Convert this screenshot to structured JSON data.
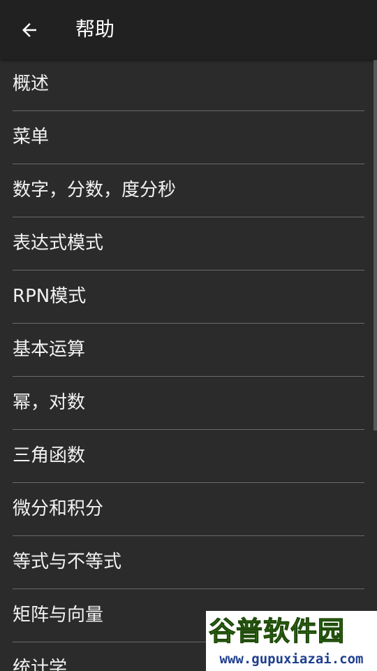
{
  "header": {
    "back_icon": "arrow-left-icon",
    "title": "帮助"
  },
  "help_topics": [
    {
      "label": "概述"
    },
    {
      "label": "菜单"
    },
    {
      "label": "数字，分数，度分秒"
    },
    {
      "label": "表达式模式"
    },
    {
      "label": "RPN模式"
    },
    {
      "label": "基本运算"
    },
    {
      "label": "幂，对数"
    },
    {
      "label": "三角函数"
    },
    {
      "label": "微分和积分"
    },
    {
      "label": "等式与不等式"
    },
    {
      "label": "矩阵与向量"
    },
    {
      "label": "统计学"
    }
  ],
  "watermark": {
    "main": "谷普软件园",
    "url": "www.gupuxiazai.com"
  },
  "colors": {
    "background": "#2b2b2b",
    "appbar": "#212121",
    "divider": "#6a6a6a",
    "text": "#f2f2f2"
  }
}
